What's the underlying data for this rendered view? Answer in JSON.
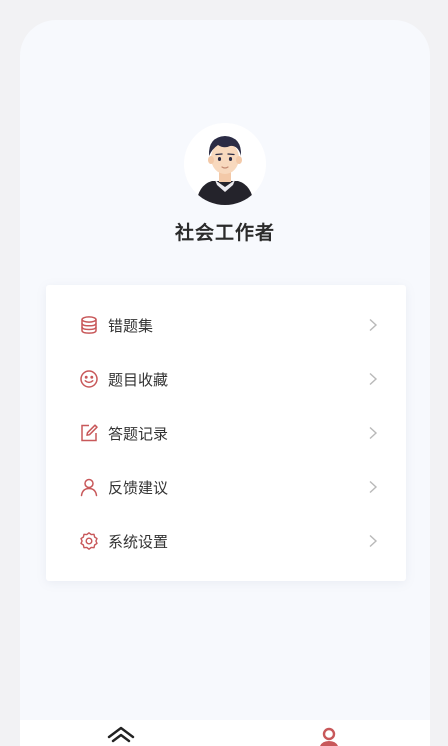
{
  "profile": {
    "username": "社会工作者"
  },
  "menu": {
    "items": [
      {
        "label": "错题集",
        "icon": "database-icon"
      },
      {
        "label": "题目收藏",
        "icon": "smile-icon"
      },
      {
        "label": "答题记录",
        "icon": "edit-icon"
      },
      {
        "label": "反馈建议",
        "icon": "user-icon"
      },
      {
        "label": "系统设置",
        "icon": "settings-icon"
      }
    ]
  },
  "tabbar": {
    "tabs": [
      {
        "icon": "home-icon",
        "active": false
      },
      {
        "icon": "profile-icon",
        "active": true
      }
    ]
  },
  "colors": {
    "accent": "#c8585a",
    "background": "#f7f9fd",
    "card": "#ffffff",
    "text": "#333333",
    "chevron": "#b9b9b9"
  }
}
